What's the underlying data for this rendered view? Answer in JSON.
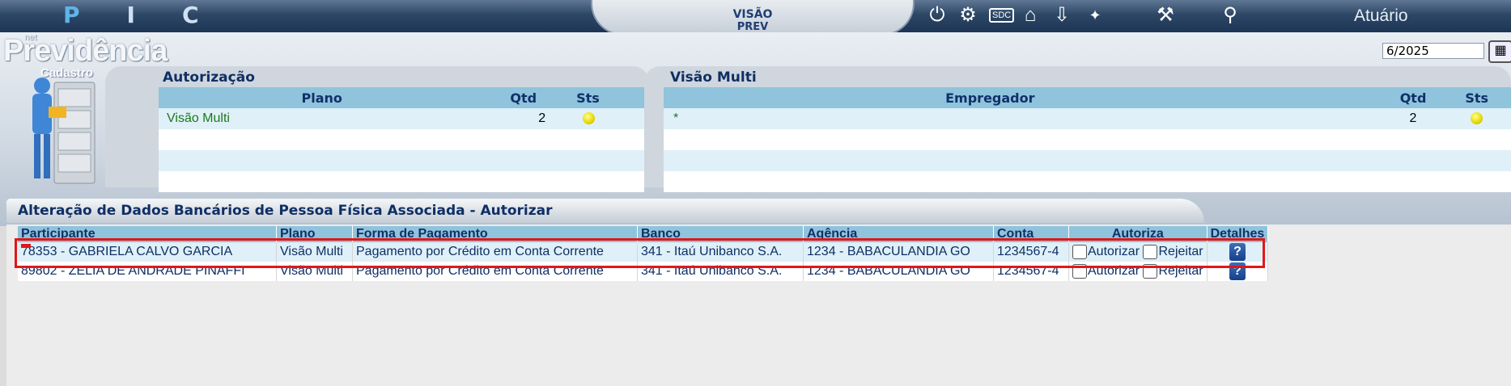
{
  "topbar": {
    "logo_letters": "P I C",
    "brand_line1": "VISÃO",
    "brand_line2": "PREV",
    "icons": [
      "power-icon",
      "gear-icon",
      "sdc-icon",
      "home-icon",
      "download-icon",
      "atuario-icon",
      "gavel-icon",
      "search-icon"
    ],
    "atuario_label": "Atuário"
  },
  "header": {
    "net_label": "net",
    "title": "Previdência",
    "subtitle": "Cadastro",
    "period": "6/2025"
  },
  "autorizacao": {
    "title": "Autorização",
    "headers": [
      "Plano",
      "Qtd",
      "Sts"
    ],
    "rows": [
      {
        "plano": "Visão Multi",
        "qtd": "2",
        "status_color": "#e6d600"
      }
    ]
  },
  "visao_multi": {
    "title": "Visão Multi",
    "headers": [
      "Empregador",
      "Qtd",
      "Sts"
    ],
    "rows": [
      {
        "empregador": "*",
        "qtd": "2",
        "status_color": "#e6d600"
      }
    ]
  },
  "main": {
    "title": "Alteração de Dados Bancários de Pessoa Física Associada - Autorizar",
    "headers": [
      "Participante",
      "Plano",
      "Forma de Pagamento",
      "Banco",
      "Agência",
      "Conta",
      "Autoriza",
      "Detalhes"
    ],
    "autorizar_label": "Autorizar",
    "rejeitar_label": "Rejeitar",
    "rows": [
      {
        "participante": "78353 - GABRIELA CALVO GARCIA",
        "plano": "Visão Multi",
        "forma": "Pagamento por Crédito em Conta Corrente",
        "banco": "341 - Itaú Unibanco S.A.",
        "agencia": "1234 - BABACULANDIA GO",
        "conta": "1234567-4"
      },
      {
        "participante": "89802 - ZELIA DE ANDRADE PINAFFI",
        "plano": "Visão Multi",
        "forma": "Pagamento por Crédito em Conta Corrente",
        "banco": "341 - Itaú Unibanco S.A.",
        "agencia": "1234 - BABACULANDIA GO",
        "conta": "1234567-4"
      }
    ]
  },
  "colors": {
    "highlight": "#e01818",
    "header_blue": "#8fc4dc",
    "text_navy": "#0f2f64",
    "link_green": "#1a7a1a"
  }
}
